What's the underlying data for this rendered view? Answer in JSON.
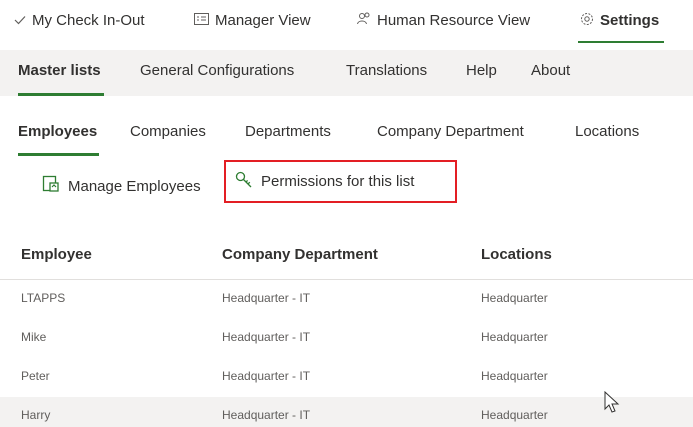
{
  "top_nav": {
    "items": [
      {
        "label": "My Check In-Out",
        "icon": "checkmark-icon"
      },
      {
        "label": "Manager View",
        "icon": "card-icon"
      },
      {
        "label": "Human Resource View",
        "icon": "people-icon"
      },
      {
        "label": "Settings",
        "icon": "gear-icon"
      }
    ],
    "active": "Settings"
  },
  "sub_nav": {
    "items": [
      "Master lists",
      "General Configurations",
      "Translations",
      "Help",
      "About"
    ],
    "active": "Master lists"
  },
  "list_tabs": {
    "items": [
      "Employees",
      "Companies",
      "Departments",
      "Company Department",
      "Locations"
    ],
    "active": "Employees"
  },
  "commands": {
    "manage_label": "Manage Employees",
    "manage_icon": "manage-list-icon",
    "permissions_label": "Permissions for this list",
    "permissions_icon": "key-icon"
  },
  "table": {
    "columns": [
      "Employee",
      "Company Department",
      "Locations"
    ],
    "rows": [
      [
        "LTAPPS",
        "Headquarter - IT",
        "Headquarter"
      ],
      [
        "Mike",
        "Headquarter - IT",
        "Headquarter"
      ],
      [
        "Peter",
        "Headquarter - IT",
        "Headquarter"
      ],
      [
        "Harry",
        "Headquarter - IT",
        "Headquarter"
      ]
    ]
  },
  "colors": {
    "accent": "#2e7d32",
    "highlight_border": "#e31e24",
    "bar_background": "#f3f2f1"
  }
}
